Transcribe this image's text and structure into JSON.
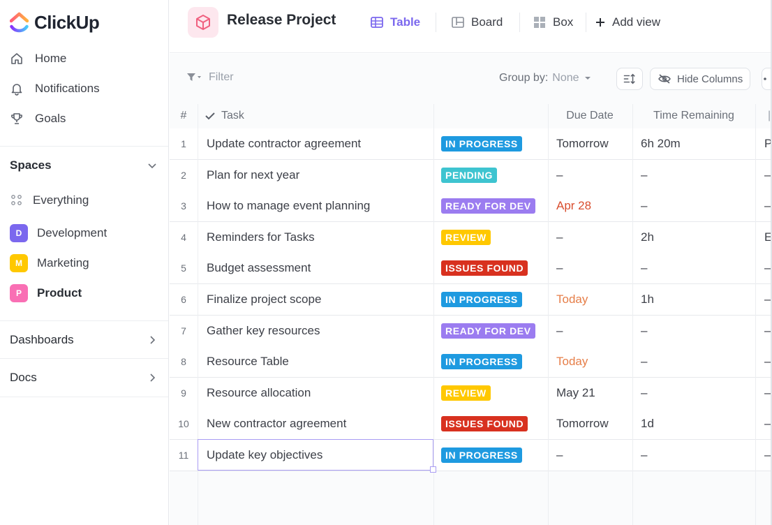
{
  "app": {
    "name": "ClickUp"
  },
  "sidebar": {
    "nav": [
      {
        "label": "Home",
        "icon": "home-icon"
      },
      {
        "label": "Notifications",
        "icon": "bell-icon"
      },
      {
        "label": "Goals",
        "icon": "trophy-icon"
      }
    ],
    "spaces_label": "Spaces",
    "everything_label": "Everything",
    "spaces": [
      {
        "letter": "D",
        "label": "Development",
        "color": "#7b68ee"
      },
      {
        "letter": "M",
        "label": "Marketing",
        "color": "#ffc800"
      },
      {
        "letter": "P",
        "label": "Product",
        "color": "#f96fb4"
      }
    ],
    "dashboards_label": "Dashboards",
    "docs_label": "Docs"
  },
  "header": {
    "project_title": "Release Project",
    "views": [
      {
        "label": "Table",
        "active": true
      },
      {
        "label": "Board",
        "active": false
      },
      {
        "label": "Box",
        "active": false
      }
    ],
    "add_view_label": "Add view"
  },
  "toolbar": {
    "filter_label": "Filter",
    "group_by_label": "Group by:",
    "group_by_value": "None",
    "hide_columns_label": "Hide Columns"
  },
  "table": {
    "columns": {
      "num": "#",
      "task": "Task",
      "due": "Due Date",
      "remaining": "Time Remaining"
    },
    "rows": [
      {
        "n": "1",
        "task": "Update contractor agreement",
        "status": "IN PROGRESS",
        "due": "Tomorrow",
        "remaining": "6h 20m",
        "extra": "P"
      },
      {
        "n": "2",
        "task": "Plan for next year",
        "status": "PENDING",
        "due": "–",
        "remaining": "–",
        "extra": "–"
      },
      {
        "n": "3",
        "task": "How to manage event planning",
        "status": "READY FOR DEV",
        "due": "Apr 28",
        "remaining": "–",
        "extra": "–"
      },
      {
        "n": "4",
        "task": "Reminders for Tasks",
        "status": "REVIEW",
        "due": "–",
        "remaining": "2h",
        "extra": "E"
      },
      {
        "n": "5",
        "task": "Budget assessment",
        "status": "ISSUES FOUND",
        "due": "–",
        "remaining": "–",
        "extra": "–"
      },
      {
        "n": "6",
        "task": "Finalize project scope",
        "status": "IN PROGRESS",
        "due": "Today",
        "remaining": "1h",
        "extra": "–"
      },
      {
        "n": "7",
        "task": "Gather key resources",
        "status": "READY FOR DEV",
        "due": "–",
        "remaining": "–",
        "extra": "–"
      },
      {
        "n": "8",
        "task": "Resource Table",
        "status": "IN PROGRESS",
        "due": "Today",
        "remaining": "–",
        "extra": "–"
      },
      {
        "n": "9",
        "task": "Resource allocation",
        "status": "REVIEW",
        "due": "May 21",
        "remaining": "–",
        "extra": "–"
      },
      {
        "n": "10",
        "task": "New contractor agreement",
        "status": "ISSUES FOUND",
        "due": "Tomorrow",
        "remaining": "1d",
        "extra": "–"
      },
      {
        "n": "11",
        "task": "Update key objectives",
        "status": "IN PROGRESS",
        "due": "–",
        "remaining": "–",
        "extra": "–"
      }
    ]
  },
  "colors": {
    "accent": "#7b68ee",
    "status_in_progress": "#1e9ae0",
    "status_pending": "#3ec4d0",
    "status_ready_for_dev": "#9b7cf0",
    "status_review": "#ffc800",
    "status_issues_found": "#d8311f",
    "due_overdue": "#d94e2f",
    "due_today": "#e67e48"
  }
}
